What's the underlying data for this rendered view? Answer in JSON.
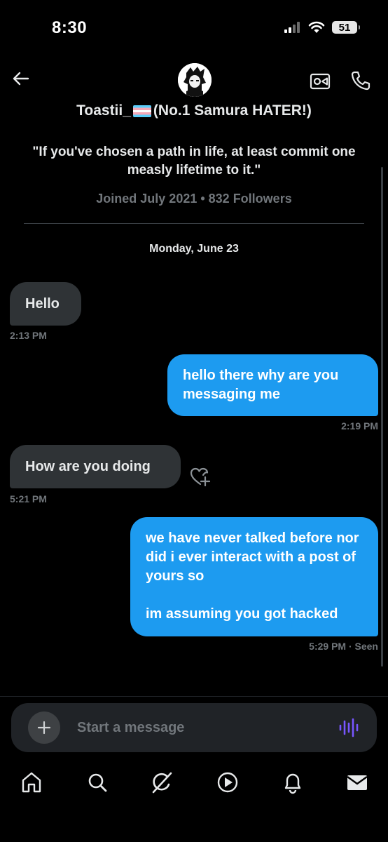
{
  "status_bar": {
    "time": "8:30",
    "battery": "51"
  },
  "header": {
    "title": "Toastii_",
    "title_suffix": "(No.1 Samura HATER!)"
  },
  "profile": {
    "bio": "\"If you've chosen a path in life, at least commit one measly lifetime to it.\"",
    "meta": "Joined July 2021 • 832 Followers"
  },
  "date_separator": "Monday, June 23",
  "messages": [
    {
      "direction": "incoming",
      "text": "Hello",
      "time": "2:13 PM"
    },
    {
      "direction": "outgoing",
      "text": "hello there why are you messaging me",
      "time": "2:19 PM"
    },
    {
      "direction": "incoming",
      "text": "How are you doing",
      "time": "5:21 PM"
    },
    {
      "direction": "outgoing",
      "text": "we have never talked before nor did i ever interact with a post of yours so\n\nim assuming you got hacked",
      "time": "5:29 PM · Seen"
    }
  ],
  "composer": {
    "placeholder": "Start a message"
  },
  "nav": {
    "items": [
      "home-icon",
      "search-icon",
      "grok-icon",
      "video-icon",
      "notifications-icon",
      "messages-icon"
    ]
  },
  "colors": {
    "accent": "#1d9bf0",
    "incoming_bubble": "#2f3336",
    "secondary_text": "#71767b",
    "mic_accent": "#7856ff"
  }
}
